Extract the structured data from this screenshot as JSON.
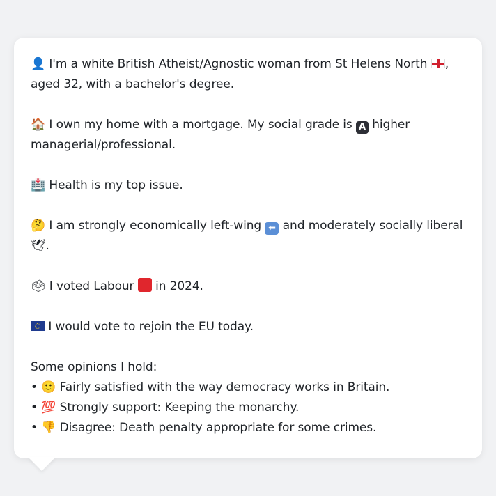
{
  "message": {
    "p1": {
      "icon": "👤",
      "text_a": "I'm a white British Atheist/Agnostic woman from St Helens North",
      "flag": "england-flag-icon",
      "text_b": ",",
      "text_c": "aged 32, with a bachelor's degree."
    },
    "p2": {
      "icon": "🏠",
      "text_a": "I own my home with a mortgage. My social grade is",
      "badge": "A",
      "text_b": "higher managerial/professional."
    },
    "p3": {
      "icon": "🏥",
      "text": "Health is my top issue."
    },
    "p4": {
      "icon": "🤔",
      "text_a": "I am strongly economically left-wing",
      "arrow": "⬅",
      "text_b": "and moderately socially liberal",
      "dove": "🕊",
      "text_c": "."
    },
    "p5": {
      "icon": "🗳",
      "text_a": "I voted Labour",
      "text_b": "in 2024."
    },
    "p6": {
      "icon": "eu-flag-icon",
      "text": "I would vote to rejoin the EU today."
    },
    "opinions": {
      "heading": "Some opinions I hold:",
      "items": [
        {
          "bullet": "•",
          "icon": "🙂",
          "text": "Fairly satisfied with the way democracy works in Britain."
        },
        {
          "bullet": "•",
          "icon": "💯",
          "text": "Strongly support: Keeping the monarchy."
        },
        {
          "bullet": "•",
          "icon": "👎",
          "text": "Disagree: Death penalty appropriate for some crimes."
        }
      ]
    }
  },
  "colors": {
    "background": "#f1f2f4",
    "bubble": "#ffffff",
    "text": "#1f2328",
    "labour_red": "#e0262d"
  }
}
